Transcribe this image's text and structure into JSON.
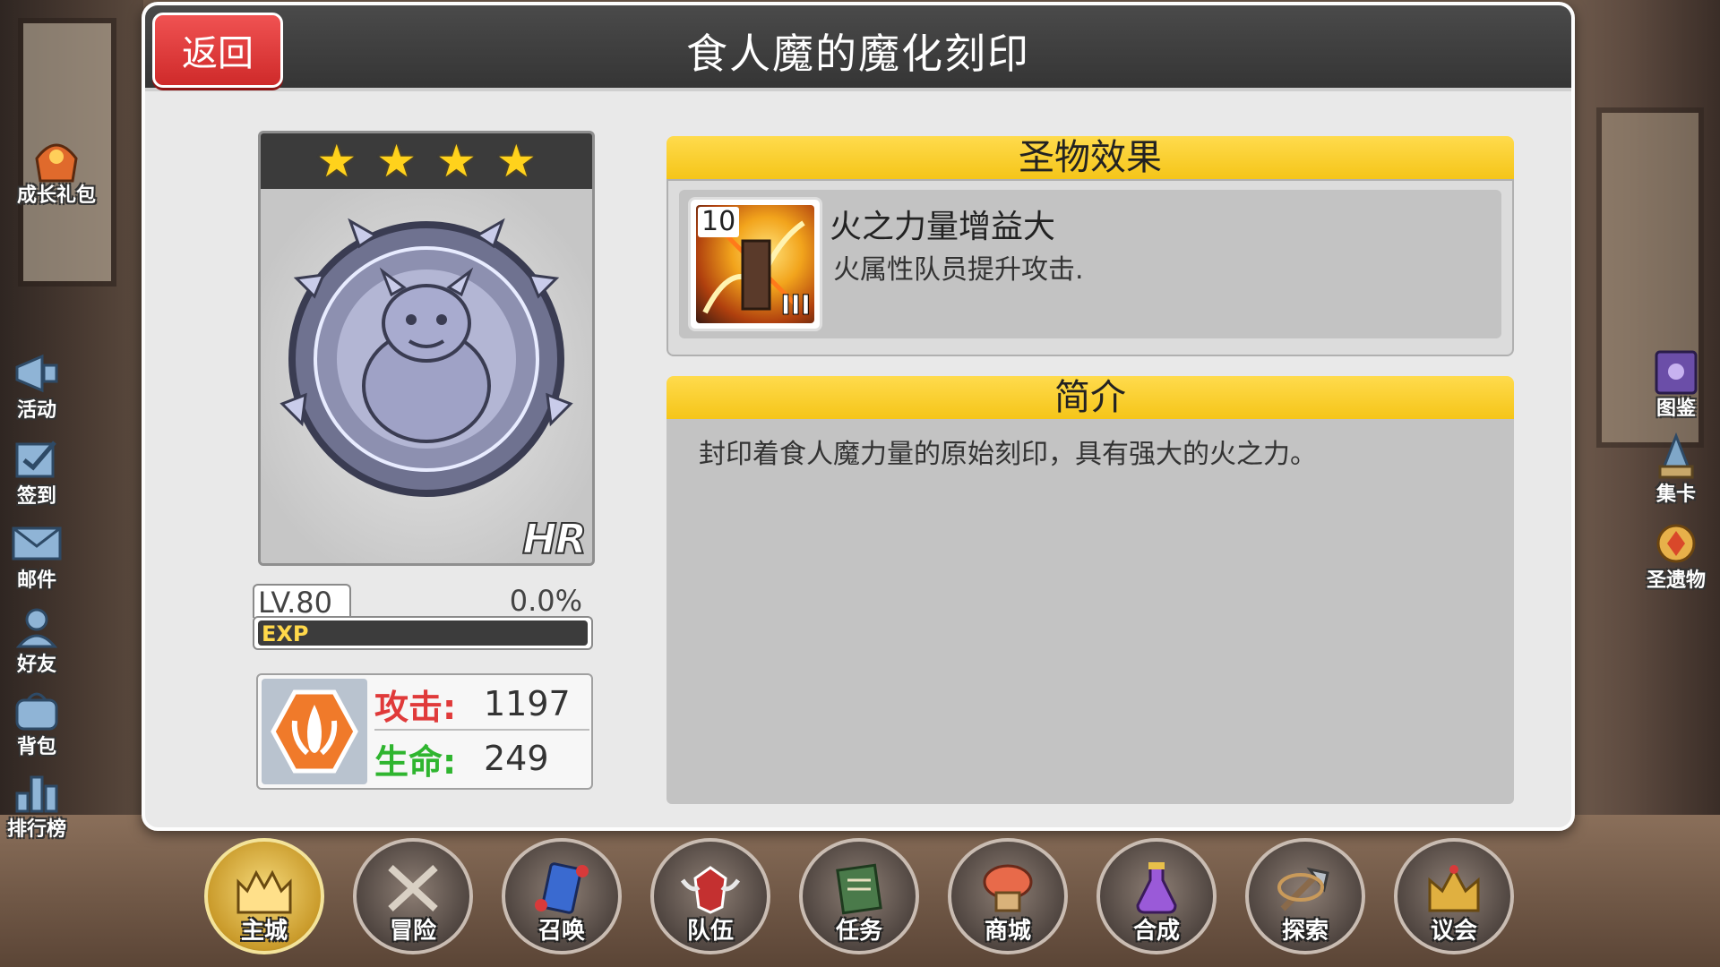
{
  "dialog": {
    "title": "食人魔的魔化刻印",
    "back_label": "返回"
  },
  "relic": {
    "stars": 4,
    "rarity": "HR",
    "level_label": "LV.80",
    "exp_percent_label": "0.0%",
    "exp_fraction": 0.0,
    "exp_label": "EXP",
    "stats": {
      "attack_label": "攻击:",
      "attack_value": "1197",
      "hp_label": "生命:",
      "hp_value": "249"
    }
  },
  "effect": {
    "header": "圣物效果",
    "skill_level": "10",
    "skill_tier": "III",
    "skill_name": "火之力量增益大",
    "skill_desc": "火属性队员提升攻击."
  },
  "intro": {
    "header": "简介",
    "text": "封印着食人魔力量的原始刻印，具有强大的火之力。"
  },
  "left_menu": [
    {
      "label": "成长礼包",
      "icon": "gift-icon"
    },
    {
      "label": "活动",
      "icon": "megaphone-icon"
    },
    {
      "label": "签到",
      "icon": "checkin-icon"
    },
    {
      "label": "邮件",
      "icon": "mail-icon"
    },
    {
      "label": "好友",
      "icon": "friends-icon"
    },
    {
      "label": "背包",
      "icon": "bag-icon"
    },
    {
      "label": "排行榜",
      "icon": "ranking-icon"
    }
  ],
  "right_menu": [
    {
      "label": "图鉴",
      "icon": "book-icon"
    },
    {
      "label": "集卡",
      "icon": "cards-icon"
    },
    {
      "label": "圣遗物",
      "icon": "relic-icon"
    }
  ],
  "bottom_nav": [
    {
      "label": "主城",
      "icon": "castle-icon",
      "active": true
    },
    {
      "label": "冒险",
      "icon": "swords-icon"
    },
    {
      "label": "召唤",
      "icon": "summon-icon"
    },
    {
      "label": "队伍",
      "icon": "team-icon"
    },
    {
      "label": "任务",
      "icon": "quest-icon"
    },
    {
      "label": "商城",
      "icon": "shop-icon"
    },
    {
      "label": "合成",
      "icon": "potion-icon"
    },
    {
      "label": "探索",
      "icon": "explore-icon"
    },
    {
      "label": "议会",
      "icon": "council-icon"
    }
  ],
  "colors": {
    "accent_yellow": "#f5c518",
    "back_red": "#cf2a2a",
    "attack_red": "#e03a3a",
    "hp_green": "#2fb52f"
  }
}
